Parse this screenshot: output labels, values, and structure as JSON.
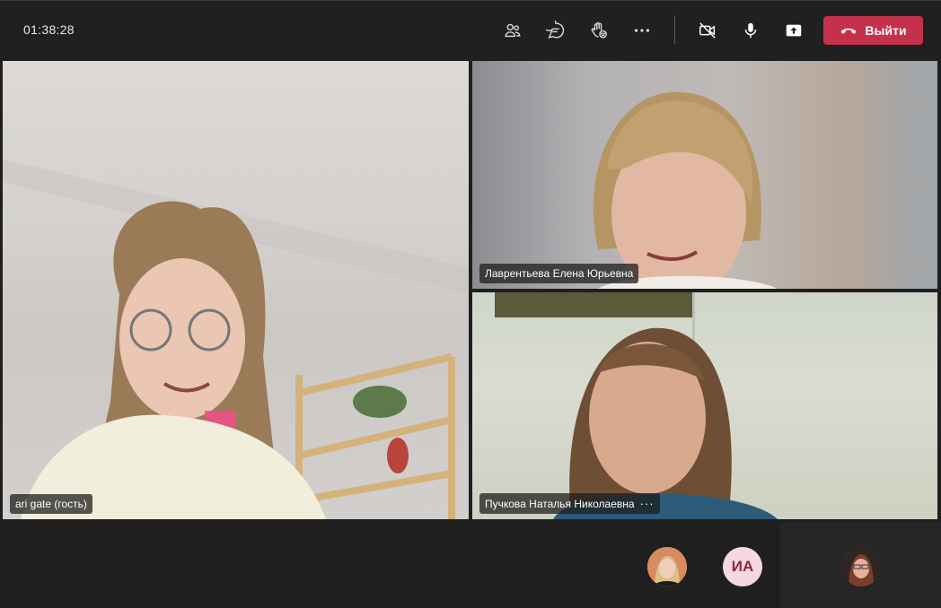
{
  "meeting": {
    "timer": "01:38:28",
    "leave_label": "Выйти"
  },
  "toolbar": {
    "icons": [
      "people-icon",
      "chat-icon",
      "raise-hand-icon",
      "more-options-icon",
      "camera-off-icon",
      "microphone-icon",
      "share-screen-icon",
      "phone-hangup-icon"
    ]
  },
  "participants": [
    {
      "name": "ari gate (гость)"
    },
    {
      "name": "Лаврентьева Елена Юрьевна"
    },
    {
      "name": "Пучкова Наталья Николаевна"
    }
  ],
  "overflow_avatars": [
    {
      "type": "photo"
    },
    {
      "type": "initials",
      "initials": "ИА"
    },
    {
      "type": "photo"
    }
  ],
  "colors": {
    "leave_button": "#c4314b",
    "background": "#1f1f1f",
    "initials_bg": "#f5d8e0",
    "initials_text": "#8b2845"
  }
}
